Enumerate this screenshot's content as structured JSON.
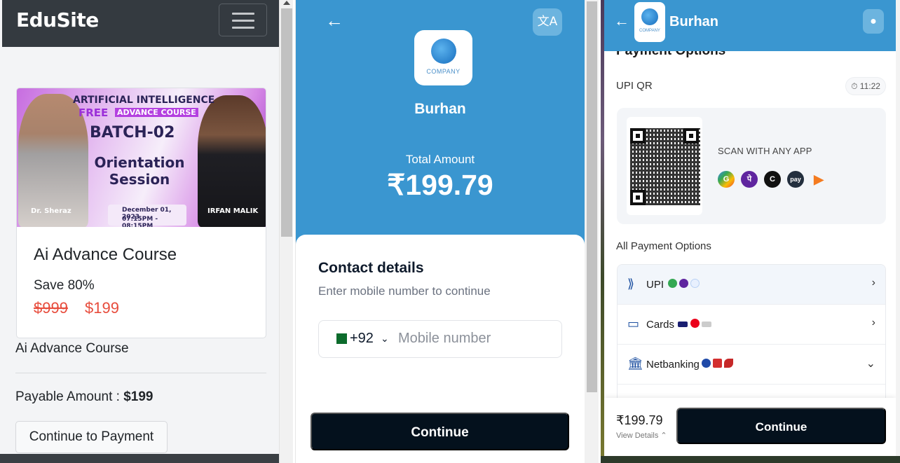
{
  "edusite": {
    "brand": "EduSite",
    "banner": {
      "line1": "ARTIFICIAL INTELLIGENCE",
      "line2_free": "FREE",
      "line2_course": "ADVANCE COURSE",
      "batch": "BATCH-02",
      "session": "Orientation Session",
      "speaker1": "Dr. Sheraz",
      "speaker2": "IRFAN MALIK",
      "date": "December 01, 2023",
      "time": "07:15PM - 08:15PM"
    },
    "card_title": "Ai Advance Course",
    "save_text": "Save 80%",
    "old_price": "$999",
    "new_price": "$199",
    "course_name": "Ai Advance Course",
    "payable_label": "Payable Amount : ",
    "payable_value": "$199",
    "pay_button": "Continue to Payment"
  },
  "checkout": {
    "merchant": "Burhan",
    "logo_text": "COMPANY",
    "total_label": "Total Amount",
    "total_amount": "₹199.79",
    "translate_icon": "translate-icon",
    "contact_title": "Contact details",
    "contact_subtitle": "Enter mobile number to continue",
    "country_code": "+92",
    "phone_placeholder": "Mobile number",
    "continue_button": "Continue"
  },
  "payment_options": {
    "merchant": "Burhan",
    "logo_text": "COMPANY",
    "section_title": "Payment Options",
    "upi_qr_label": "UPI QR",
    "timer": "11:22",
    "scan_text": "SCAN WITH ANY APP",
    "all_options_label": "All Payment Options",
    "methods": [
      {
        "label": "UPI"
      },
      {
        "label": "Cards"
      },
      {
        "label": "Netbanking"
      }
    ],
    "footer_amount": "₹199.79",
    "view_details": "View Details",
    "continue_button": "Continue"
  },
  "colors": {
    "primary_blue": "#3a96d0",
    "dark_button": "#04111d",
    "price_red": "#e74c3c",
    "navbar": "#343a40"
  }
}
